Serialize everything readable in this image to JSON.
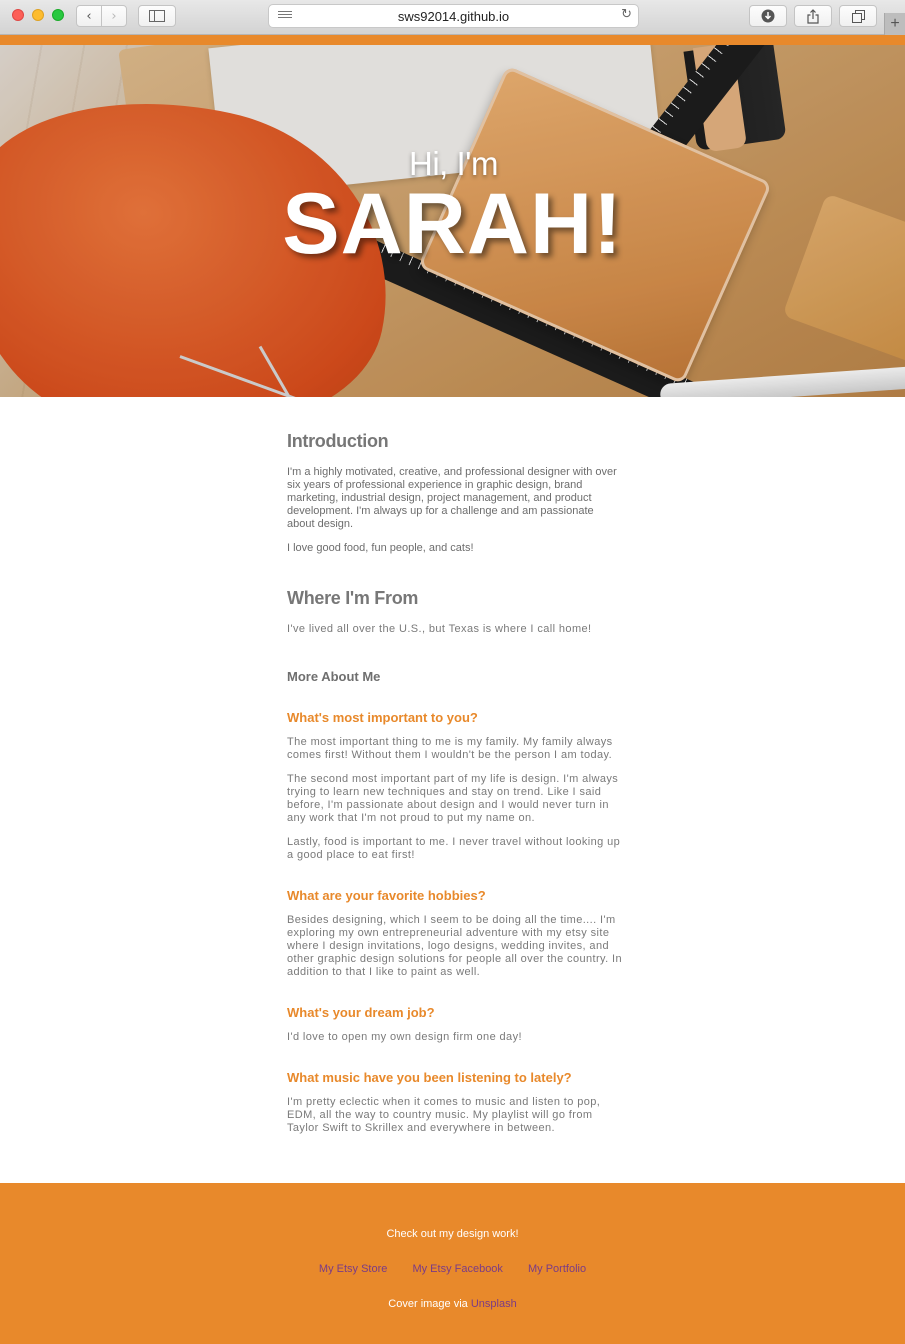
{
  "browser": {
    "url": "sws92014.github.io",
    "back_glyph": "‹",
    "forward_glyph": "›",
    "reload_glyph": "↻",
    "download_glyph": "⬇",
    "share_glyph": "⇪",
    "tabs_glyph": "⧉",
    "newtab_glyph": "+"
  },
  "hero": {
    "greeting": "Hi, I'm",
    "name": "SARAH!"
  },
  "intro": {
    "heading": "Introduction",
    "paragraph1": "I'm a highly motivated, creative, and professional designer with over six years of professional experience in graphic design, brand marketing, industrial design, project management, and product development. I'm always up for a challenge and am passionate about design.",
    "paragraph2": "I love good food, fun people, and cats!"
  },
  "from": {
    "heading": "Where I'm From",
    "text": "I've lived all over the U.S., but Texas is where I call home!"
  },
  "more": {
    "heading": "More About Me",
    "q1": {
      "question": "What's most important to you?",
      "answers": [
        "The most important thing to me is my family. My family always comes first! Without them I wouldn't be the person I am today.",
        "The second most important part of my life is design. I'm always trying to learn new techniques and stay on trend. Like I said before, I'm passionate about design and I would never turn in any work that I'm not proud to put my name on.",
        "Lastly, food is important to me. I never travel without looking up a good place to eat first!"
      ]
    },
    "q2": {
      "question": "What are your favorite hobbies?",
      "answer": "Besides designing, which I seem to be doing all the time.... I'm exploring my own entrepreneurial adventure with my etsy site where I design invitations, logo designs, wedding invites, and other graphic design solutions for people all over the country. In addition to that I like to paint as well."
    },
    "q3": {
      "question": "What's your dream job?",
      "answer": "I'd love to open my own design firm one day!"
    },
    "q4": {
      "question": "What music have you been listening to lately?",
      "answer": "I'm pretty eclectic when it comes to music and listen to pop, EDM, all the way to country music. My playlist will go from Taylor Swift to Skrillex and everywhere in between."
    }
  },
  "footer": {
    "cta": "Check out my design work!",
    "links": [
      "My Etsy Store",
      "My Etsy Facebook",
      "My Portfolio"
    ],
    "credit_prefix": "Cover image via",
    "credit_link": "Unsplash"
  }
}
